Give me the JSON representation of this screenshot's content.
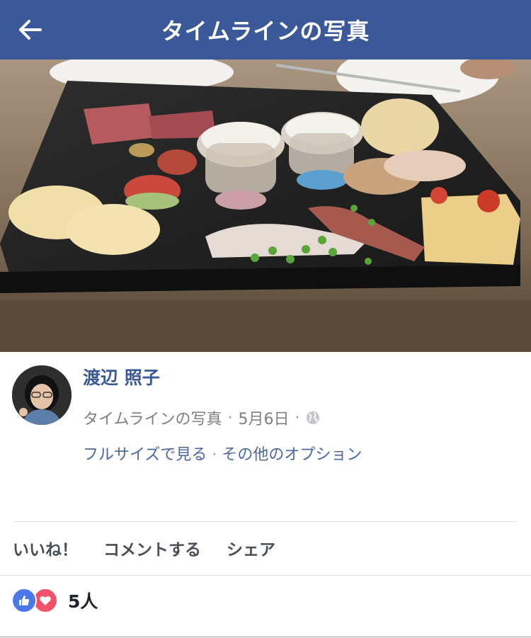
{
  "header": {
    "title": "タイムラインの写真",
    "back_icon": "arrow-left-icon",
    "background": "#3b5998"
  },
  "photo": {
    "subject": "food-platter-photo"
  },
  "post": {
    "author_name": "渡辺 照子",
    "meta": {
      "album": "タイムラインの写真",
      "date": "5月6日",
      "privacy_icon": "globe-icon"
    },
    "links": {
      "full_size": "フルサイズで見る",
      "more_options": "その他のオプション"
    }
  },
  "actions": {
    "like": "いいね！",
    "comment": "コメントする",
    "share": "シェア"
  },
  "reactions": {
    "icons": [
      "thumbs-up-icon",
      "heart-icon"
    ],
    "count": "5人",
    "like_color": "#4a78e8",
    "love_color": "#f25268"
  }
}
